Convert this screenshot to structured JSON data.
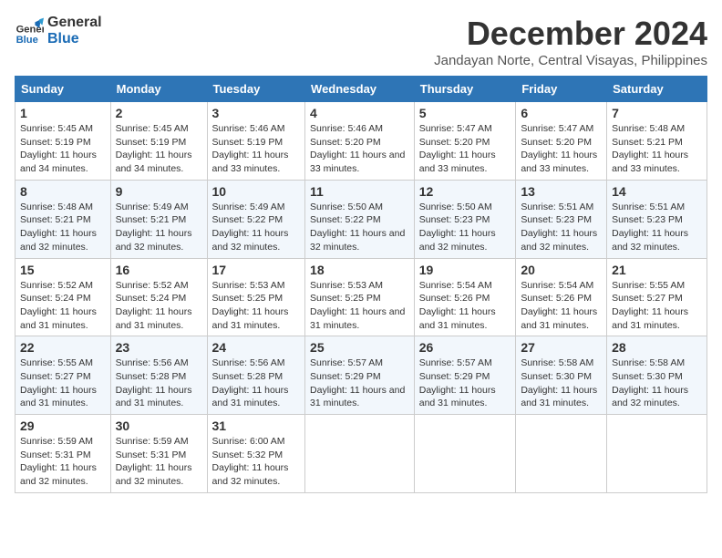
{
  "header": {
    "logo_line1": "General",
    "logo_line2": "Blue",
    "month_title": "December 2024",
    "subtitle": "Jandayan Norte, Central Visayas, Philippines"
  },
  "weekdays": [
    "Sunday",
    "Monday",
    "Tuesday",
    "Wednesday",
    "Thursday",
    "Friday",
    "Saturday"
  ],
  "weeks": [
    [
      {
        "day": "1",
        "sunrise": "5:45 AM",
        "sunset": "5:19 PM",
        "daylight": "11 hours and 34 minutes."
      },
      {
        "day": "2",
        "sunrise": "5:45 AM",
        "sunset": "5:19 PM",
        "daylight": "11 hours and 34 minutes."
      },
      {
        "day": "3",
        "sunrise": "5:46 AM",
        "sunset": "5:19 PM",
        "daylight": "11 hours and 33 minutes."
      },
      {
        "day": "4",
        "sunrise": "5:46 AM",
        "sunset": "5:20 PM",
        "daylight": "11 hours and 33 minutes."
      },
      {
        "day": "5",
        "sunrise": "5:47 AM",
        "sunset": "5:20 PM",
        "daylight": "11 hours and 33 minutes."
      },
      {
        "day": "6",
        "sunrise": "5:47 AM",
        "sunset": "5:20 PM",
        "daylight": "11 hours and 33 minutes."
      },
      {
        "day": "7",
        "sunrise": "5:48 AM",
        "sunset": "5:21 PM",
        "daylight": "11 hours and 33 minutes."
      }
    ],
    [
      {
        "day": "8",
        "sunrise": "5:48 AM",
        "sunset": "5:21 PM",
        "daylight": "11 hours and 32 minutes."
      },
      {
        "day": "9",
        "sunrise": "5:49 AM",
        "sunset": "5:21 PM",
        "daylight": "11 hours and 32 minutes."
      },
      {
        "day": "10",
        "sunrise": "5:49 AM",
        "sunset": "5:22 PM",
        "daylight": "11 hours and 32 minutes."
      },
      {
        "day": "11",
        "sunrise": "5:50 AM",
        "sunset": "5:22 PM",
        "daylight": "11 hours and 32 minutes."
      },
      {
        "day": "12",
        "sunrise": "5:50 AM",
        "sunset": "5:23 PM",
        "daylight": "11 hours and 32 minutes."
      },
      {
        "day": "13",
        "sunrise": "5:51 AM",
        "sunset": "5:23 PM",
        "daylight": "11 hours and 32 minutes."
      },
      {
        "day": "14",
        "sunrise": "5:51 AM",
        "sunset": "5:23 PM",
        "daylight": "11 hours and 32 minutes."
      }
    ],
    [
      {
        "day": "15",
        "sunrise": "5:52 AM",
        "sunset": "5:24 PM",
        "daylight": "11 hours and 31 minutes."
      },
      {
        "day": "16",
        "sunrise": "5:52 AM",
        "sunset": "5:24 PM",
        "daylight": "11 hours and 31 minutes."
      },
      {
        "day": "17",
        "sunrise": "5:53 AM",
        "sunset": "5:25 PM",
        "daylight": "11 hours and 31 minutes."
      },
      {
        "day": "18",
        "sunrise": "5:53 AM",
        "sunset": "5:25 PM",
        "daylight": "11 hours and 31 minutes."
      },
      {
        "day": "19",
        "sunrise": "5:54 AM",
        "sunset": "5:26 PM",
        "daylight": "11 hours and 31 minutes."
      },
      {
        "day": "20",
        "sunrise": "5:54 AM",
        "sunset": "5:26 PM",
        "daylight": "11 hours and 31 minutes."
      },
      {
        "day": "21",
        "sunrise": "5:55 AM",
        "sunset": "5:27 PM",
        "daylight": "11 hours and 31 minutes."
      }
    ],
    [
      {
        "day": "22",
        "sunrise": "5:55 AM",
        "sunset": "5:27 PM",
        "daylight": "11 hours and 31 minutes."
      },
      {
        "day": "23",
        "sunrise": "5:56 AM",
        "sunset": "5:28 PM",
        "daylight": "11 hours and 31 minutes."
      },
      {
        "day": "24",
        "sunrise": "5:56 AM",
        "sunset": "5:28 PM",
        "daylight": "11 hours and 31 minutes."
      },
      {
        "day": "25",
        "sunrise": "5:57 AM",
        "sunset": "5:29 PM",
        "daylight": "11 hours and 31 minutes."
      },
      {
        "day": "26",
        "sunrise": "5:57 AM",
        "sunset": "5:29 PM",
        "daylight": "11 hours and 31 minutes."
      },
      {
        "day": "27",
        "sunrise": "5:58 AM",
        "sunset": "5:30 PM",
        "daylight": "11 hours and 31 minutes."
      },
      {
        "day": "28",
        "sunrise": "5:58 AM",
        "sunset": "5:30 PM",
        "daylight": "11 hours and 32 minutes."
      }
    ],
    [
      {
        "day": "29",
        "sunrise": "5:59 AM",
        "sunset": "5:31 PM",
        "daylight": "11 hours and 32 minutes."
      },
      {
        "day": "30",
        "sunrise": "5:59 AM",
        "sunset": "5:31 PM",
        "daylight": "11 hours and 32 minutes."
      },
      {
        "day": "31",
        "sunrise": "6:00 AM",
        "sunset": "5:32 PM",
        "daylight": "11 hours and 32 minutes."
      },
      null,
      null,
      null,
      null
    ]
  ]
}
